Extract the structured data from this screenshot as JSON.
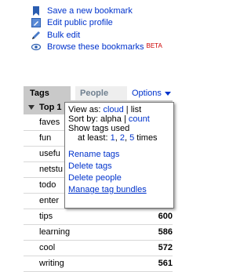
{
  "bookmark_actions": [
    {
      "label": "Save a new bookmark",
      "icon": "bookmark-icon"
    },
    {
      "label": "Edit public profile",
      "icon": "edit-profile-icon"
    },
    {
      "label": "Bulk edit",
      "icon": "pencil-icon"
    },
    {
      "label": "Browse these bookmarks",
      "icon": "eye-icon",
      "badge": "BETA"
    }
  ],
  "tabs": {
    "tags": "Tags",
    "people": "People",
    "options": "Options"
  },
  "top_header": "Top 1",
  "tags": [
    {
      "name": "faves",
      "count": ""
    },
    {
      "name": "fun",
      "count": ""
    },
    {
      "name": "usefu",
      "count": ""
    },
    {
      "name": "netstu",
      "count": ""
    },
    {
      "name": "todo",
      "count": ""
    },
    {
      "name": "enter",
      "count": ""
    },
    {
      "name": "tips",
      "count": "600"
    },
    {
      "name": "learning",
      "count": "586"
    },
    {
      "name": "cool",
      "count": "572"
    },
    {
      "name": "writing",
      "count": "561"
    }
  ],
  "popup": {
    "view_as_label": "View as:",
    "view_cloud": "cloud",
    "view_sep": "|",
    "view_list": "list",
    "sort_by_label": "Sort by:",
    "sort_alpha": "alpha",
    "sort_sep": "|",
    "sort_count": "count",
    "show_tags_label": "Show tags used",
    "at_least_label": "at least:",
    "at_least_1": "1",
    "at_least_2": "2",
    "at_least_5": "5",
    "times_label": "times",
    "menu": [
      "Rename tags",
      "Delete tags",
      "Delete people",
      "Manage tag bundles"
    ]
  },
  "colors": {
    "link": "#0033cc",
    "beta": "#cc0000",
    "tab_active": "#c9c9c9",
    "tab_inactive": "#eeeeee"
  }
}
